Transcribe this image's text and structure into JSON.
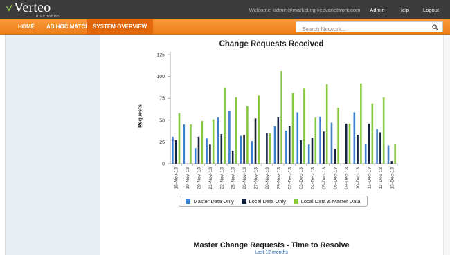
{
  "app": {
    "logo_text": "Verteo",
    "logo_sub": "BIOPHARMA",
    "welcome_label": "Welcome",
    "user_email": "admin@marketing.veevanetwork.com",
    "top_links": [
      "Admin",
      "Help",
      "Logout"
    ]
  },
  "nav": {
    "items": [
      "HOME",
      "AD HOC MATCH",
      "SYSTEM OVERVIEW"
    ],
    "active": "SYSTEM OVERVIEW"
  },
  "search": {
    "placeholder": "Search Network..."
  },
  "colors": {
    "brand_orange": "#f2871f",
    "master": "#3a7fd2",
    "local": "#15253f",
    "both": "#86c83e"
  },
  "chart": {
    "title": "Change Requests Received",
    "ylabel": "Requests",
    "legend": [
      "Master Data Only",
      "Local Data Only",
      "Local Data & Master Data"
    ]
  },
  "chart_data": {
    "type": "bar",
    "title": "Change Requests Received",
    "ylabel": "Requests",
    "ylim": [
      0,
      125
    ],
    "yticks": [
      0,
      25,
      50,
      75,
      100,
      125
    ],
    "categories": [
      "18-Nov-13",
      "19-Nov-13",
      "20-Nov-13",
      "21-Nov-13",
      "22-Nov-13",
      "25-Nov-13",
      "26-Nov-13",
      "27-Nov-13",
      "28-Nov-13",
      "29-Nov-13",
      "02-Dec-13",
      "03-Dec-13",
      "04-Dec-13",
      "05-Dec-13",
      "06-Dec-13",
      "09-Dec-13",
      "10-Dec-13",
      "11-Dec-13",
      "12-Dec-13",
      "13-Dec-13"
    ],
    "series": [
      {
        "name": "Master Data Only",
        "color": "#3a7fd2",
        "values": [
          31,
          45,
          18,
          29,
          53,
          61,
          32,
          26,
          0,
          43,
          38,
          59,
          22,
          54,
          47,
          0,
          59,
          23,
          40,
          21
        ]
      },
      {
        "name": "Local Data Only",
        "color": "#15253f",
        "values": [
          27,
          0,
          31,
          22,
          34,
          15,
          33,
          52,
          35,
          53,
          43,
          27,
          30,
          37,
          17,
          46,
          33,
          46,
          36,
          3
        ]
      },
      {
        "name": "Local Data & Master Data",
        "color": "#86c83e",
        "values": [
          58,
          45,
          49,
          51,
          87,
          76,
          66,
          78,
          35,
          106,
          81,
          86,
          53,
          91,
          64,
          46,
          92,
          69,
          76,
          23
        ]
      }
    ],
    "grid": false,
    "legend_position": "bottom"
  },
  "chart2": {
    "title": "Master Change Requests - Time to Resolve",
    "subtitle": "Last 12 months"
  }
}
